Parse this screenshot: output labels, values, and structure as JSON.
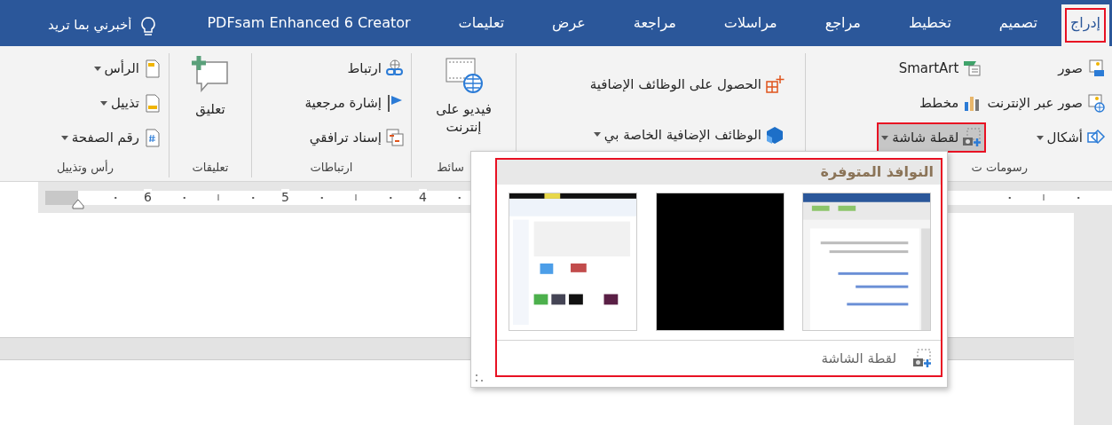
{
  "tabs": [
    {
      "label": "إدراج",
      "selected": true,
      "highlighted": true
    },
    {
      "label": "تصميم",
      "selected": false,
      "highlighted": false
    },
    {
      "label": "تخطيط",
      "selected": false,
      "highlighted": false
    },
    {
      "label": "مراجع",
      "selected": false,
      "highlighted": false
    },
    {
      "label": "مراسلات",
      "selected": false,
      "highlighted": false
    },
    {
      "label": "مراجعة",
      "selected": false,
      "highlighted": false
    },
    {
      "label": "عرض",
      "selected": false,
      "highlighted": false
    },
    {
      "label": "تعليمات",
      "selected": false,
      "highlighted": false
    },
    {
      "label": "PDFsam Enhanced 6 Creator",
      "selected": false,
      "highlighted": false
    }
  ],
  "tell_me": {
    "placeholder": "أخبرني بما تريد"
  },
  "ribbon": {
    "groups": [
      {
        "kind": "columns",
        "label": "رسومات ت",
        "columns": [
          [
            {
              "label": "صور",
              "menu": false,
              "pressed": false,
              "highlighted": false
            },
            {
              "label": "صور عبر الإنترنت",
              "menu": false,
              "pressed": false,
              "highlighted": false
            },
            {
              "label": "أشكال",
              "menu": true,
              "pressed": false,
              "highlighted": false
            }
          ],
          [
            {
              "label": "SmartArt",
              "menu": false,
              "pressed": false,
              "highlighted": false
            },
            {
              "label": "مخطط",
              "menu": false,
              "pressed": false,
              "highlighted": false
            },
            {
              "label": "لقطة شاشة",
              "menu": true,
              "pressed": true,
              "highlighted": true
            }
          ]
        ]
      },
      {
        "kind": "columns",
        "columns": [
          [
            {
              "label": "الحصول على الوظائف الإضافية",
              "menu": false,
              "pressed": false,
              "highlighted": false
            },
            {
              "label": "الوظائف الإضافية الخاصة بي",
              "menu": true,
              "pressed": false,
              "highlighted": false
            }
          ]
        ]
      },
      {
        "kind": "large",
        "label": "سائط",
        "button": {
          "label": "فيديو على إنترنت"
        }
      },
      {
        "kind": "columns",
        "label": "ارتباطات",
        "columns": [
          [
            {
              "label": "ارتباط",
              "menu": false,
              "pressed": false,
              "highlighted": false
            },
            {
              "label": "إشارة مرجعية",
              "menu": false,
              "pressed": false,
              "highlighted": false
            },
            {
              "label": "إسناد ترافقي",
              "menu": false,
              "pressed": false,
              "highlighted": false
            }
          ]
        ]
      },
      {
        "kind": "large",
        "label": "تعليقات",
        "button": {
          "label": "تعليق"
        }
      },
      {
        "kind": "columns",
        "label": "رأس وتذييل",
        "columns": [
          [
            {
              "label": "الرأس",
              "menu": true,
              "pressed": false,
              "highlighted": false
            },
            {
              "label": "تذييل",
              "menu": true,
              "pressed": false,
              "highlighted": false
            },
            {
              "label": "رقم الصفحة",
              "menu": true,
              "pressed": false,
              "highlighted": false
            }
          ]
        ]
      }
    ]
  },
  "ruler": {
    "numbers": [
      "4",
      "5",
      "6"
    ]
  },
  "screenshot_menu": {
    "highlighted": true,
    "header": "النوافذ المتوفرة",
    "windows": [
      {
        "kind": "document"
      },
      {
        "kind": "blank"
      },
      {
        "kind": "explorer"
      }
    ],
    "footer": "لقطة الشاشة"
  }
}
